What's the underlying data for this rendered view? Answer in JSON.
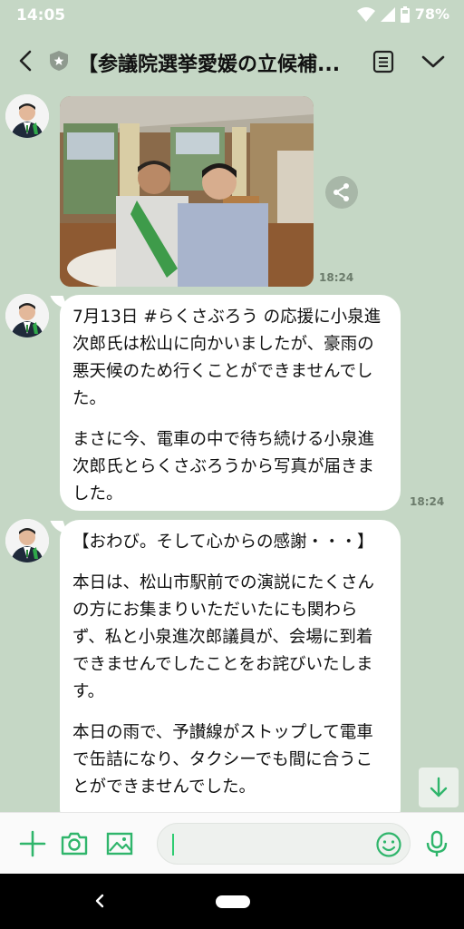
{
  "status": {
    "time": "14:05",
    "battery": "78%"
  },
  "header": {
    "title": "【参議院選挙愛媛の立候補..."
  },
  "messages": [
    {
      "type": "photo",
      "time": "18:24"
    },
    {
      "type": "text",
      "time": "18:24",
      "paragraphs": [
        "7月13日 #らくさぶろう の応援に小泉進次郎氏は松山に向かいましたが、豪雨の悪天候のため行くことができませんでした。",
        "まさに今、電車の中で待ち続ける小泉進次郎氏とらくさぶろうから写真が届きました。"
      ]
    },
    {
      "type": "text",
      "paragraphs": [
        "【おわび。そして心からの感謝・・・】",
        "本日は、松山市駅前での演説にたくさんの方にお集まりいただいたにも関わらず、私と小泉進次郎議員が、会場に到着できませんでしたことをお詫びいたします。",
        "本日の雨で、予讃線がストップして電車で缶詰になり、タクシーでも間に合うことができませんでした。"
      ]
    }
  ],
  "colors": {
    "accent": "#2fb56b",
    "background": "#c5d7c5"
  }
}
